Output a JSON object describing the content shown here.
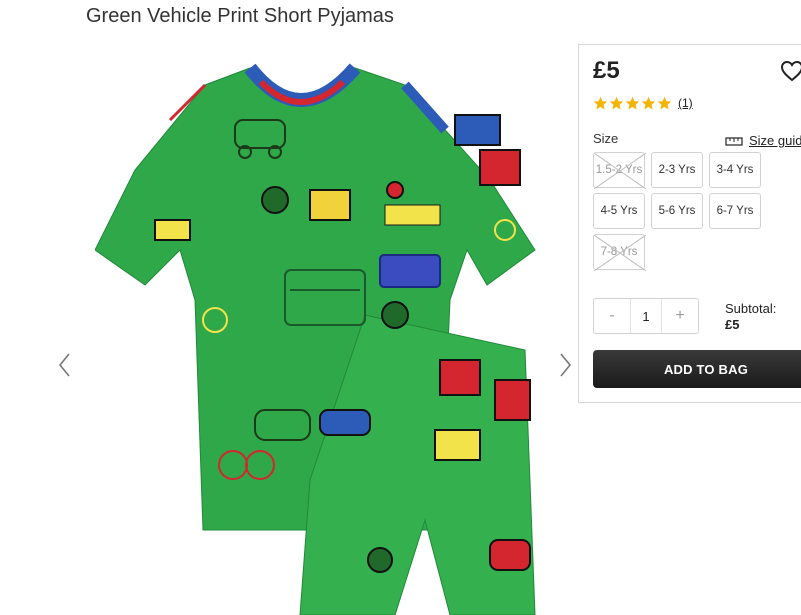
{
  "product": {
    "title": "Green Vehicle Print Short Pyjamas",
    "price": "£5",
    "rating": 5,
    "review_count": "(1)"
  },
  "gallery": {
    "prev_icon": "chevron-left-icon",
    "next_icon": "chevron-right-icon",
    "colors": {
      "fabric": "#2fa84a",
      "collar_blue": "#2c5bb8",
      "collar_red": "#d3262e"
    }
  },
  "size_section": {
    "label": "Size",
    "guide_label": "Size guide",
    "options": [
      {
        "label": "1.5-2 Yrs",
        "available": false
      },
      {
        "label": "2-3 Yrs",
        "available": true
      },
      {
        "label": "3-4 Yrs",
        "available": true
      },
      {
        "label": "4-5 Yrs",
        "available": true
      },
      {
        "label": "5-6 Yrs",
        "available": true
      },
      {
        "label": "6-7 Yrs",
        "available": true
      },
      {
        "label": "7-8 Yrs",
        "available": false
      }
    ]
  },
  "quantity": {
    "minus": "-",
    "value": "1",
    "plus": "+"
  },
  "subtotal": {
    "label": "Subtotal:",
    "amount": "£5"
  },
  "cta": {
    "add_to_bag": "ADD TO BAG"
  },
  "colors": {
    "star": "#f5b301",
    "button": "#222222",
    "border": "#d2d2d2"
  }
}
